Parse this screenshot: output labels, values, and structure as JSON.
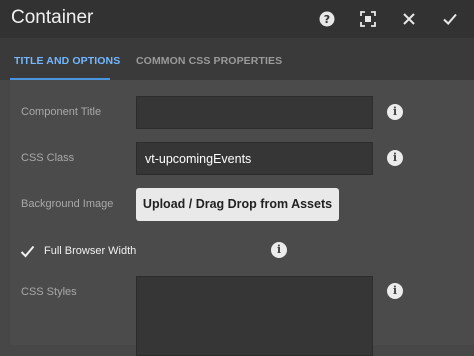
{
  "dialog": {
    "title": "Container"
  },
  "tabs": [
    {
      "label": "TITLE AND OPTIONS",
      "active": true
    },
    {
      "label": "COMMON CSS PROPERTIES",
      "active": false
    }
  ],
  "form": {
    "component_title": {
      "label": "Component Title",
      "value": ""
    },
    "css_class": {
      "label": "CSS Class",
      "value": "vt-upcomingEvents"
    },
    "background_image": {
      "label": "Background Image",
      "button_label": "Upload / Drag Drop from Assets"
    },
    "full_browser_width": {
      "label": "Full Browser Width",
      "checked": true
    },
    "css_styles": {
      "label": "CSS Styles",
      "value": ""
    }
  },
  "icons": {
    "help": "help-icon",
    "fullscreen": "fullscreen-icon",
    "close": "close-icon",
    "confirm": "checkmark-icon",
    "info": "info-icon"
  },
  "colors": {
    "accent": "#72b7ff",
    "header_bg": "#323232",
    "panel_bg": "#4b4b4b"
  }
}
